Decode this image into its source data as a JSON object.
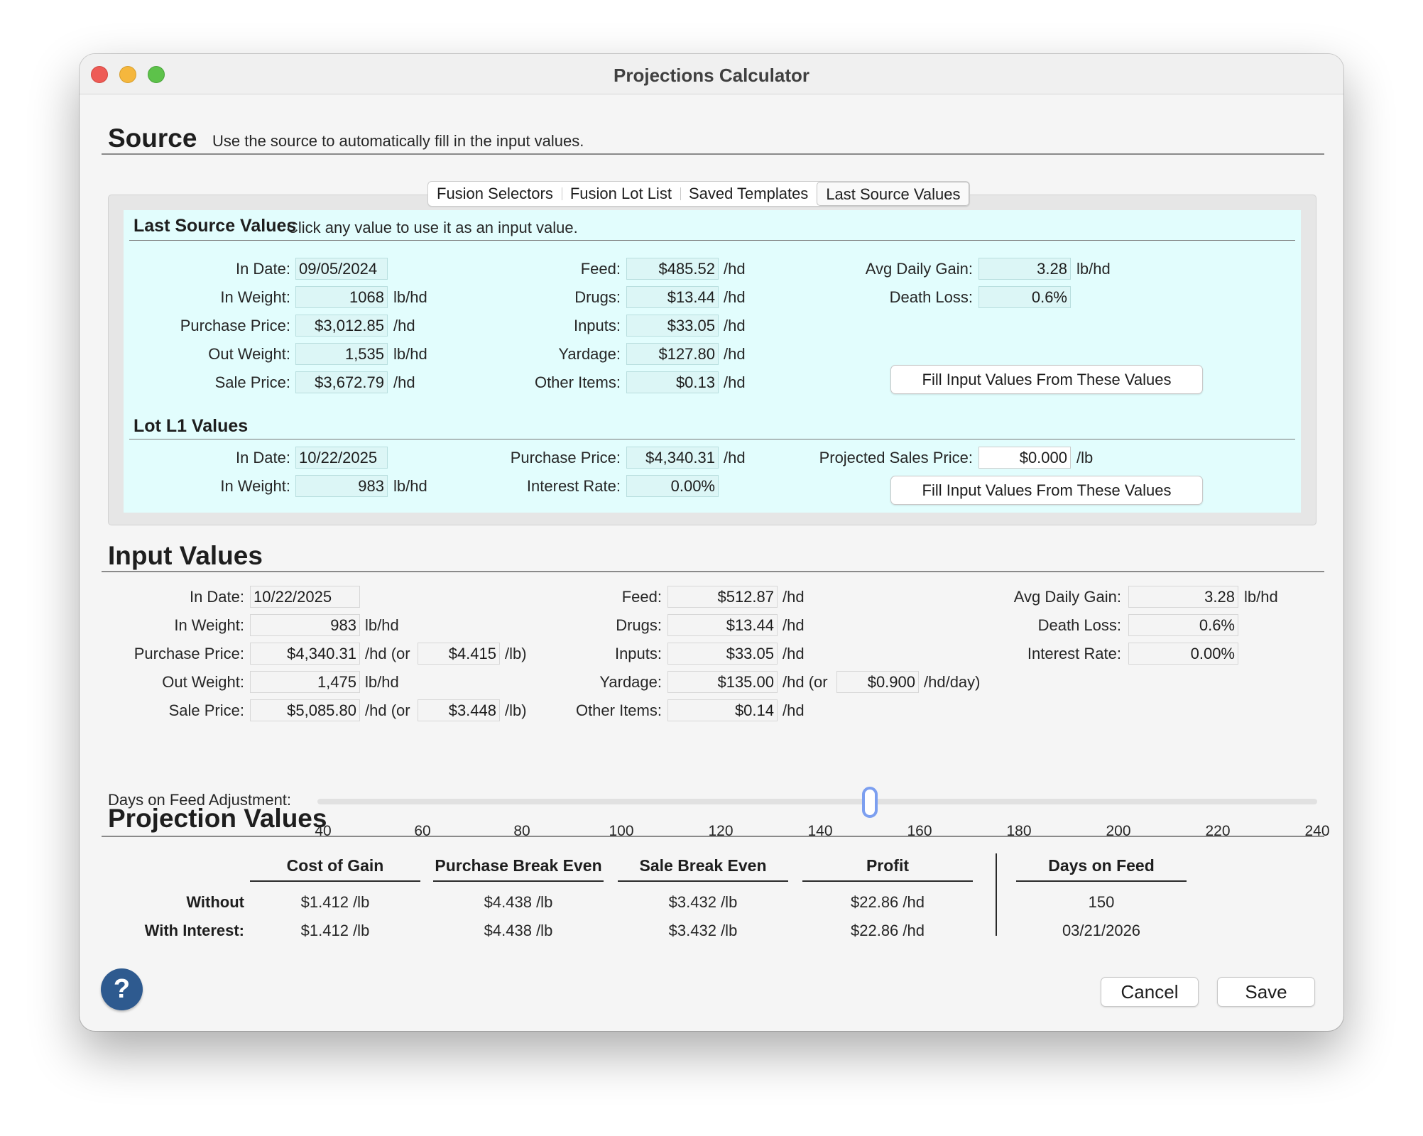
{
  "window": {
    "title": "Projections Calculator"
  },
  "source": {
    "heading": "Source",
    "description": "Use the source to automatically fill in the input values.",
    "tabs": [
      "Fusion Selectors",
      "Fusion Lot List",
      "Saved Templates",
      "Last Source Values"
    ],
    "selected_tab": "Last Source Values"
  },
  "last_source": {
    "heading": "Last Source Values",
    "description": "Click any value to use it as an input value.",
    "in_date": {
      "label": "In Date:",
      "value": "09/05/2024"
    },
    "in_weight": {
      "label": "In Weight:",
      "value": "1068",
      "unit": "lb/hd"
    },
    "purchase_price": {
      "label": "Purchase Price:",
      "value": "$3,012.85",
      "unit": "/hd"
    },
    "out_weight": {
      "label": "Out Weight:",
      "value": "1,535",
      "unit": "lb/hd"
    },
    "sale_price": {
      "label": "Sale Price:",
      "value": "$3,672.79",
      "unit": "/hd"
    },
    "feed": {
      "label": "Feed:",
      "value": "$485.52",
      "unit": "/hd"
    },
    "drugs": {
      "label": "Drugs:",
      "value": "$13.44",
      "unit": "/hd"
    },
    "inputs": {
      "label": "Inputs:",
      "value": "$33.05",
      "unit": "/hd"
    },
    "yardage": {
      "label": "Yardage:",
      "value": "$127.80",
      "unit": "/hd"
    },
    "other_items": {
      "label": "Other Items:",
      "value": "$0.13",
      "unit": "/hd"
    },
    "avg_daily_gain": {
      "label": "Avg Daily Gain:",
      "value": "3.28",
      "unit": "lb/hd"
    },
    "death_loss": {
      "label": "Death Loss:",
      "value": "0.6%"
    },
    "fill_button": "Fill Input Values From These Values"
  },
  "lot_values": {
    "heading": "Lot L1 Values",
    "in_date": {
      "label": "In Date:",
      "value": "10/22/2025"
    },
    "in_weight": {
      "label": "In Weight:",
      "value": "983",
      "unit": "lb/hd"
    },
    "purchase_price": {
      "label": "Purchase Price:",
      "value": "$4,340.31",
      "unit": "/hd"
    },
    "interest_rate": {
      "label": "Interest Rate:",
      "value": "0.00%"
    },
    "projected_sales_price": {
      "label": "Projected Sales Price:",
      "value": "$0.000",
      "unit": "/lb"
    },
    "fill_button": "Fill Input Values From These Values"
  },
  "input_values": {
    "heading": "Input Values",
    "in_date": {
      "label": "In Date:",
      "value": "10/22/2025"
    },
    "in_weight": {
      "label": "In Weight:",
      "value": "983",
      "unit": "lb/hd"
    },
    "purchase_price": {
      "label": "Purchase Price:",
      "value": "$4,340.31",
      "unit": "/hd (or",
      "per_lb": "$4.415",
      "per_lb_unit": "/lb)"
    },
    "out_weight": {
      "label": "Out Weight:",
      "value": "1,475",
      "unit": "lb/hd"
    },
    "sale_price": {
      "label": "Sale Price:",
      "value": "$5,085.80",
      "unit": "/hd (or",
      "per_lb": "$3.448",
      "per_lb_unit": "/lb)"
    },
    "feed": {
      "label": "Feed:",
      "value": "$512.87",
      "unit": "/hd"
    },
    "drugs": {
      "label": "Drugs:",
      "value": "$13.44",
      "unit": "/hd"
    },
    "inputs": {
      "label": "Inputs:",
      "value": "$33.05",
      "unit": "/hd"
    },
    "yardage": {
      "label": "Yardage:",
      "value": "$135.00",
      "unit": "/hd (or",
      "per_day": "$0.900",
      "per_day_unit": "/hd/day)"
    },
    "other_items": {
      "label": "Other Items:",
      "value": "$0.14",
      "unit": "/hd"
    },
    "avg_daily_gain": {
      "label": "Avg Daily Gain:",
      "value": "3.28",
      "unit": "lb/hd"
    },
    "death_loss": {
      "label": "Death Loss:",
      "value": "0.6%"
    },
    "interest_rate": {
      "label": "Interest Rate:",
      "value": "0.00%"
    }
  },
  "days_on_feed_slider": {
    "label": "Days on Feed Adjustment:",
    "ticks": [
      "40",
      "60",
      "80",
      "100",
      "120",
      "140",
      "160",
      "180",
      "200",
      "220",
      "240"
    ],
    "min": 40,
    "max": 240,
    "value": 150,
    "accent_color": "#7c9ff0"
  },
  "projection_values": {
    "heading": "Projection Values",
    "columns": [
      "Cost of Gain",
      "Purchase Break Even",
      "Sale Break Even",
      "Profit",
      "Days on Feed"
    ],
    "rows": [
      {
        "label": "Without",
        "values": [
          "$1.412 /lb",
          "$4.438 /lb",
          "$3.432 /lb",
          "$22.86 /hd",
          "150"
        ]
      },
      {
        "label": "With Interest:",
        "values": [
          "$1.412 /lb",
          "$4.438 /lb",
          "$3.432 /lb",
          "$22.86 /hd",
          "03/21/2026"
        ]
      }
    ]
  },
  "footer": {
    "help_icon": "question-mark-icon",
    "help_glyph": "?",
    "cancel_label": "Cancel",
    "save_label": "Save"
  },
  "colors": {
    "source_panel_bg": "#e2fdfd",
    "help_button": "#2e5a8f",
    "close": "#ee5b56",
    "minimize": "#f5b73d",
    "zoom": "#5dc24a"
  }
}
